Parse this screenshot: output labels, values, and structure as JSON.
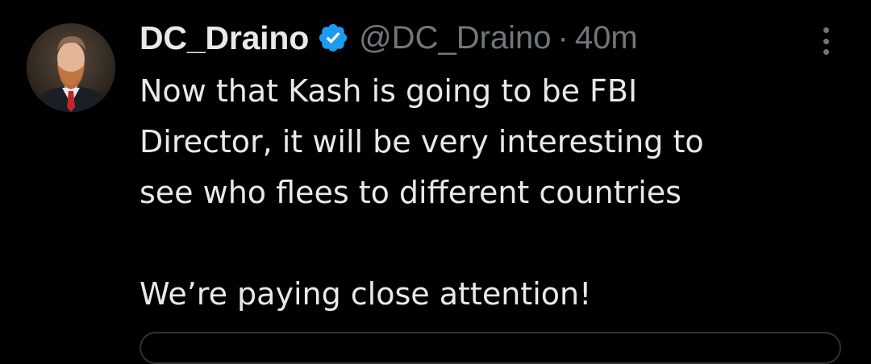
{
  "tweet": {
    "display_name": "DC_Draino",
    "handle": "@DC_Draino",
    "separator": "·",
    "time": "40m",
    "text": "Now that Kash is going to be FBI\nDirector, it will be very interesting to\nsee who flees to different countries\n\nWe’re paying close attention!",
    "verified": true,
    "avatar_icon": "user-avatar",
    "more_icon": "more-vertical-icon"
  },
  "colors": {
    "background": "#000000",
    "text_primary": "#e7e9ea",
    "text_secondary": "#71767b",
    "verified_blue": "#1d9bf0",
    "border": "#2f3336"
  }
}
